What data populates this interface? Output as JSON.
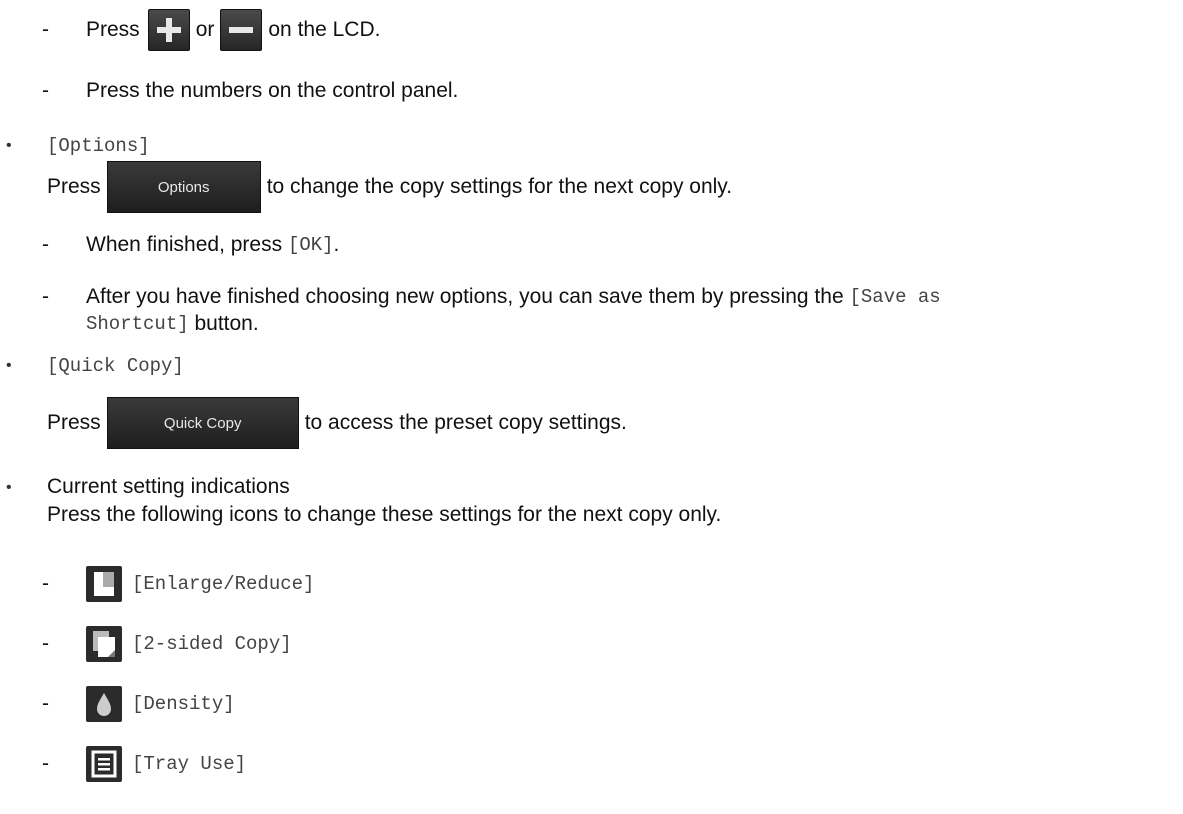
{
  "counter": {
    "press": "Press",
    "or": "or",
    "suffix": "on the LCD.",
    "keypad": "Press the numbers on the control panel."
  },
  "options": {
    "title": "[Options]",
    "press": "Press",
    "button": "Options",
    "text": "to change the copy settings for the next copy only.",
    "finished_a": "When finished, press ",
    "finished_ok": "[OK]",
    "finished_b": ".",
    "save_a": "After you have finished choosing new options, you can save them by pressing the ",
    "save_code1": "[Save as",
    "save_code2": "Shortcut]",
    "save_b": " button."
  },
  "quick_copy": {
    "title": "[Quick Copy]",
    "press": "Press",
    "button": "Quick Copy",
    "text": "to access the preset copy settings."
  },
  "current": {
    "title": "Current setting indications",
    "desc": "Press the following icons to change these settings for the next copy only.",
    "items": [
      {
        "icon": "enlarge-reduce-icon",
        "label": "[Enlarge/Reduce]"
      },
      {
        "icon": "two-sided-copy-icon",
        "label": "[2-sided Copy]"
      },
      {
        "icon": "density-icon",
        "label": "[Density]"
      },
      {
        "icon": "tray-use-icon",
        "label": "[Tray Use]"
      }
    ]
  }
}
